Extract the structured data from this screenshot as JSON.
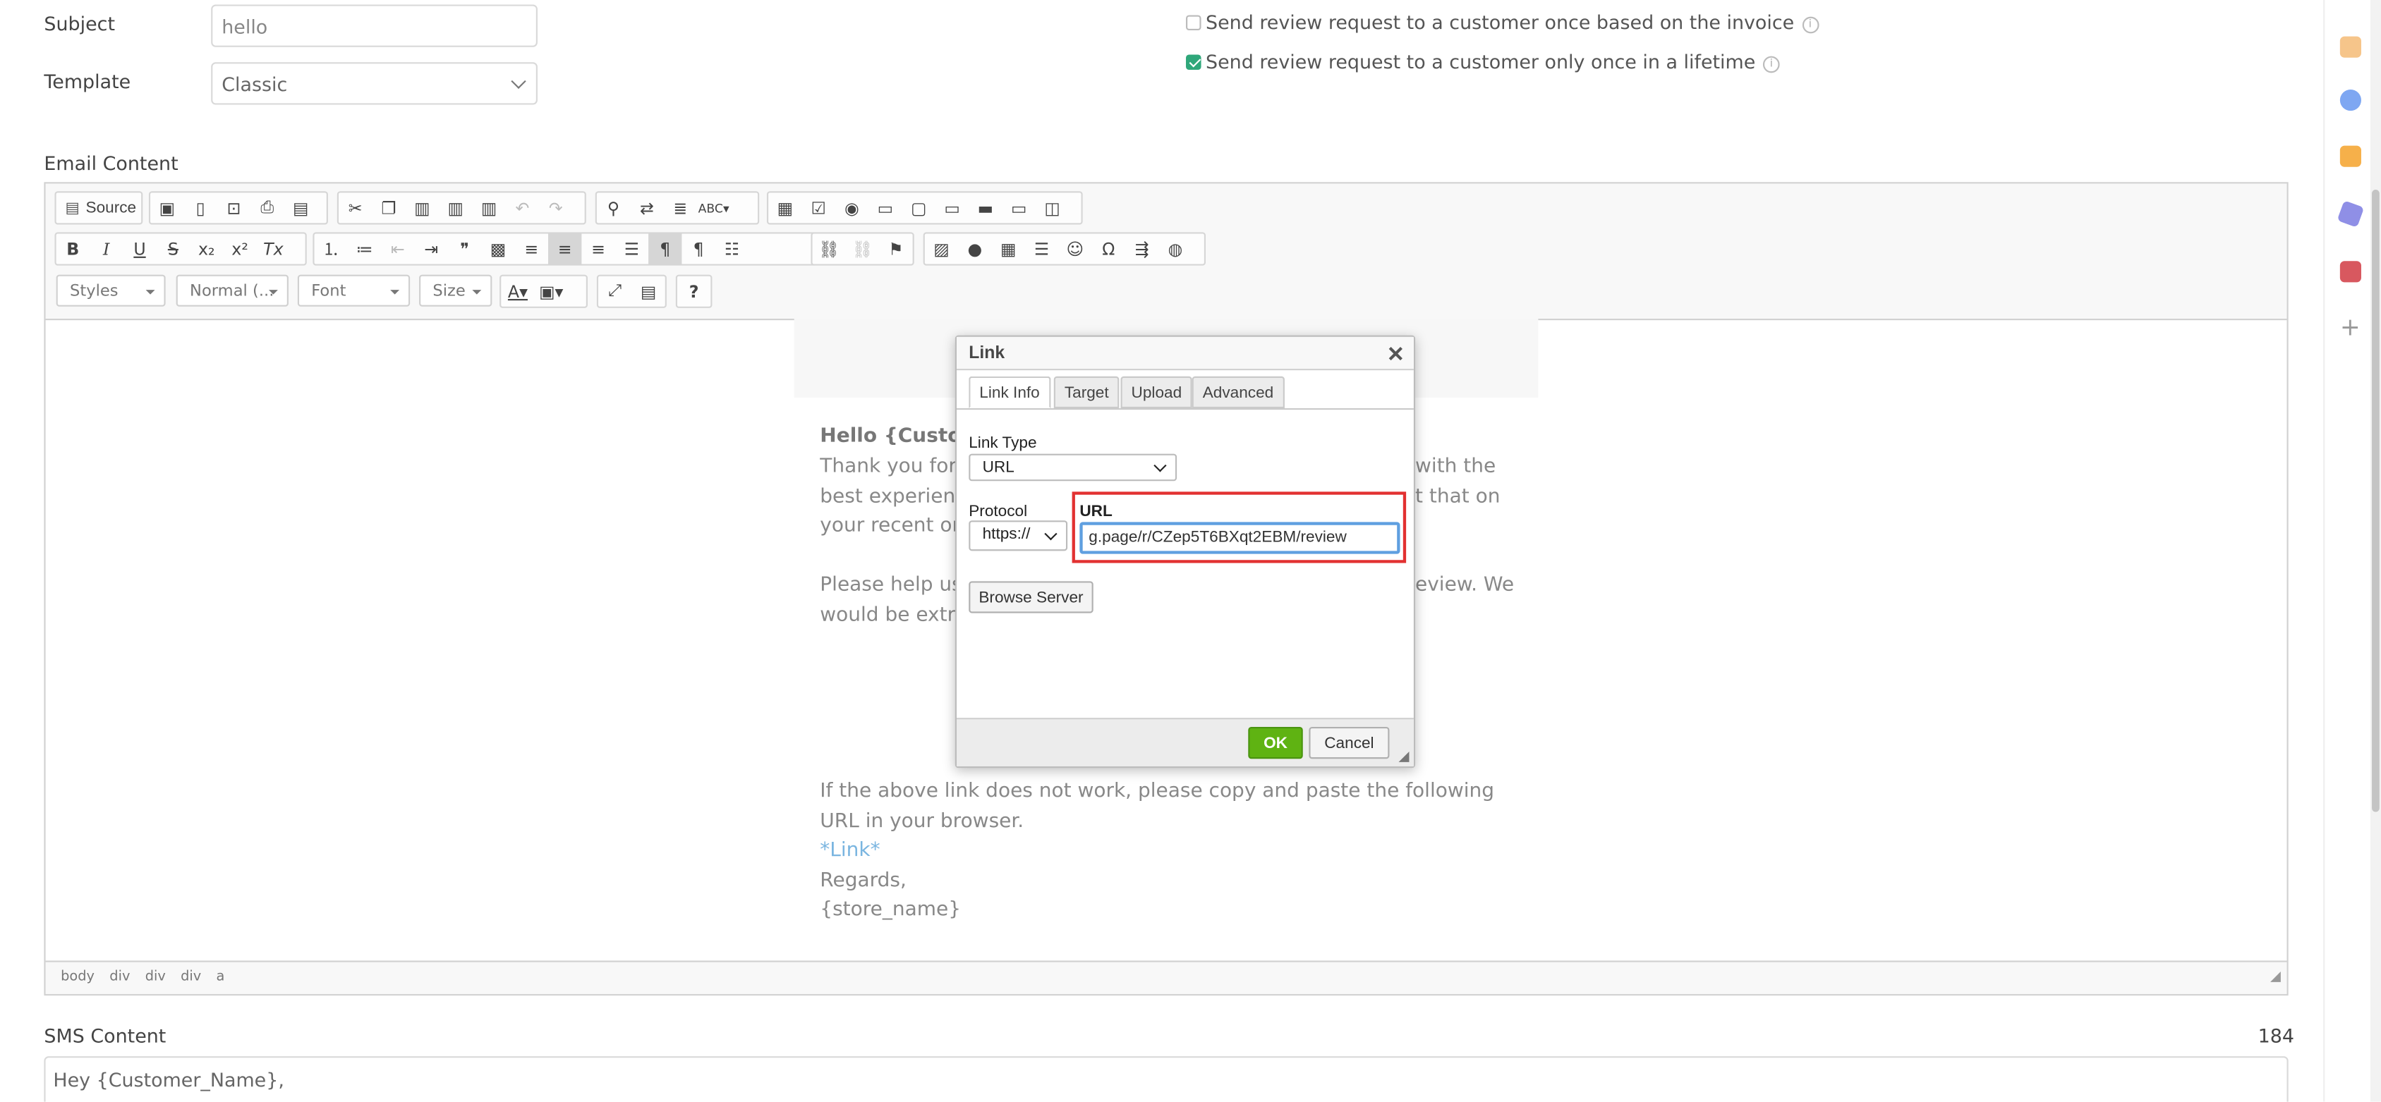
{
  "form": {
    "subject_label": "Subject",
    "subject_value": "hello",
    "template_label": "Template",
    "template_value": "Classic",
    "option_invoice": "Send review request to a customer once based on the invoice",
    "option_lifetime": "Send review request to a customer only once in a lifetime",
    "email_content_label": "Email Content"
  },
  "toolbar": {
    "source_label": "Source",
    "styles": "Styles",
    "format": "Normal (...",
    "font": "Font",
    "size": "Size"
  },
  "email": {
    "greeting": "Hello {Custome",
    "p1_line1": "Thank you for b",
    "p1_line1_tail": "with the",
    "p1_line2": "best experience",
    "p1_line2_tail": "t that on",
    "p1_line3": "your recent ord",
    "p2_line1": "Please help us i",
    "p2_line1_tail": "eview. We",
    "p2_line2": "would be extrer",
    "p3": "If the above link does not work, please copy and paste the following URL in your browser.",
    "link": "*Link*",
    "regards": "Regards,",
    "store": "{store_name}"
  },
  "statusbar": [
    "body",
    "div",
    "div",
    "div",
    "a"
  ],
  "dialog": {
    "title": "Link",
    "close": "✕",
    "tabs": [
      "Link Info",
      "Target",
      "Upload",
      "Advanced"
    ],
    "link_type_label": "Link Type",
    "link_type_value": "URL",
    "protocol_label": "Protocol",
    "protocol_value": "https://",
    "url_label": "URL",
    "url_value": "g.page/r/CZep5T6BXqt2EBM/review",
    "browse_label": "Browse Server",
    "ok_label": "OK",
    "cancel_label": "Cancel"
  },
  "sms": {
    "label": "SMS Content",
    "count": "184",
    "text": "Hey {Customer_Name},"
  },
  "colors": {
    "accent_green": "#2fa77a",
    "ok_green": "#5fb312",
    "highlight_red": "#e23131",
    "link_blue": "#7ab5e0"
  }
}
